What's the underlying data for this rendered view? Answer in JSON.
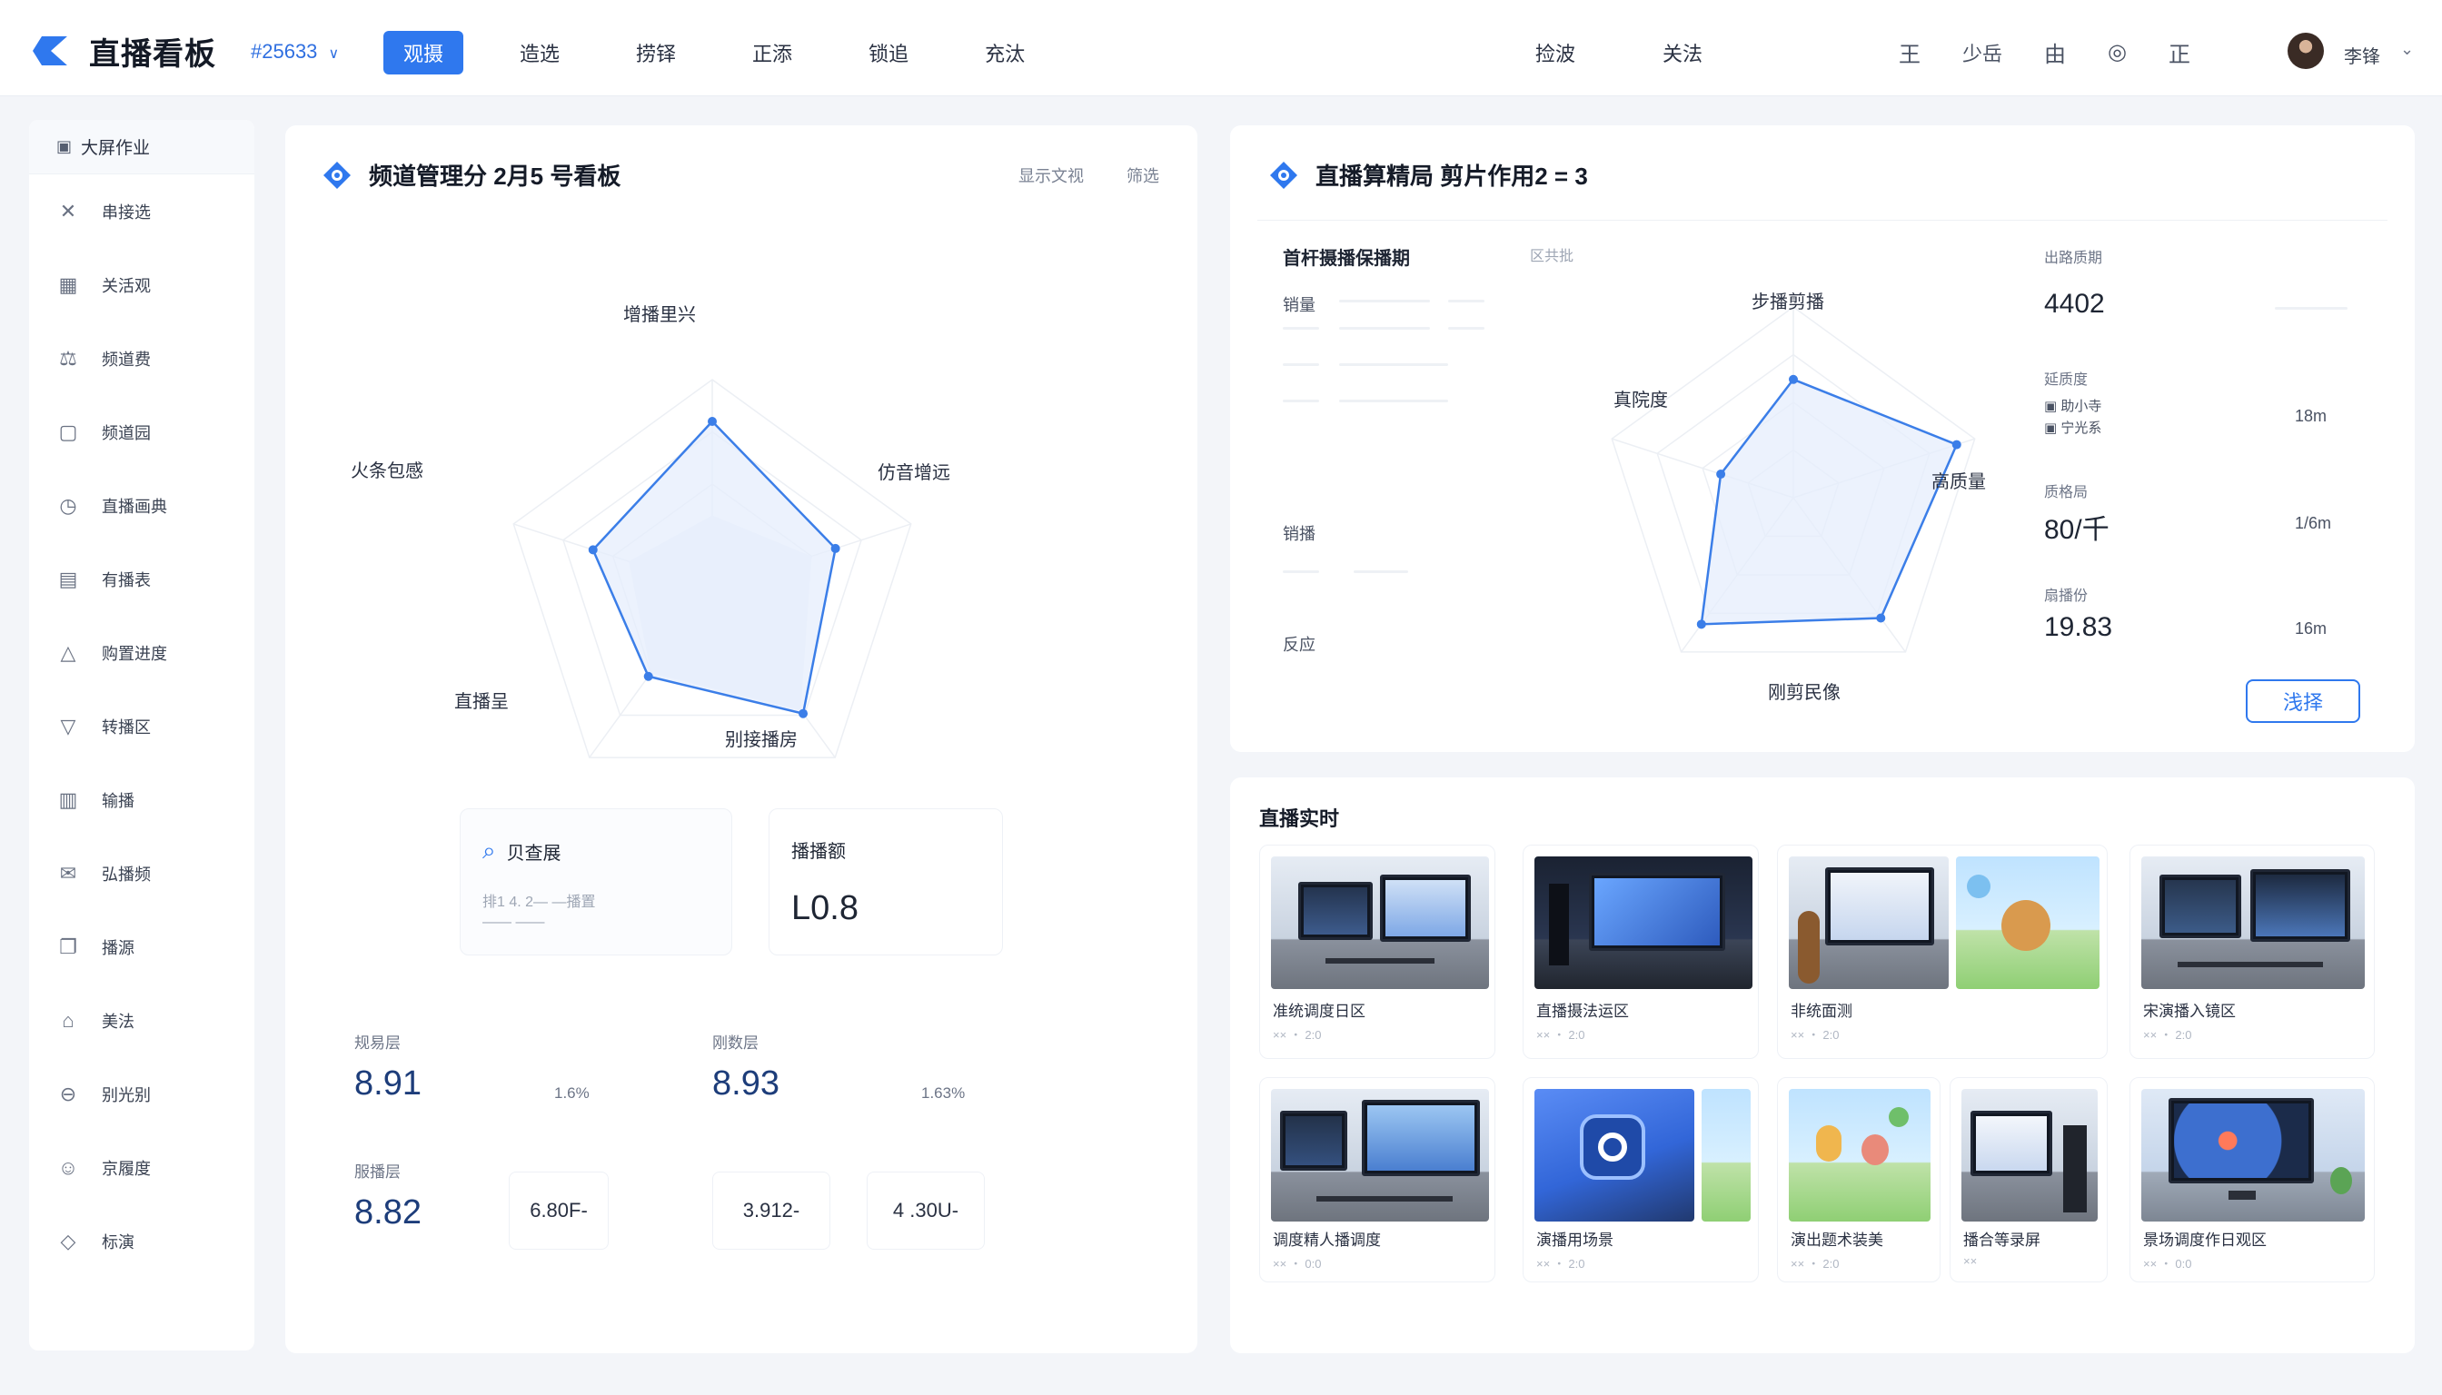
{
  "app": {
    "title": "直播看板",
    "project_id": "#25633",
    "project_caret": "∨"
  },
  "nav": {
    "items": [
      {
        "label": "观摄",
        "active": true
      },
      {
        "label": "造选",
        "active": false
      },
      {
        "label": "捞铎",
        "active": false
      },
      {
        "label": "正添",
        "active": false
      },
      {
        "label": "锁追",
        "active": false
      },
      {
        "label": "充汰",
        "active": false
      }
    ],
    "right_items": [
      "捡波",
      "关法"
    ]
  },
  "toolbar": {
    "items": [
      {
        "label": "王",
        "icon": "menu-icon"
      },
      {
        "label": "少岳",
        "icon": "text-icon"
      },
      {
        "label": "由",
        "icon": "box-icon"
      },
      {
        "label": "◎",
        "icon": "settings-icon"
      },
      {
        "label": "正",
        "icon": "doc-icon"
      }
    ],
    "username": "李锋",
    "user_caret": "⌄"
  },
  "sidebar": {
    "header": "大屏作业",
    "items": [
      {
        "label": "串接选",
        "icon": "tool-icon",
        "glyph": "✕"
      },
      {
        "label": "关活观",
        "icon": "calendar-icon",
        "glyph": "▦"
      },
      {
        "label": "频道费",
        "icon": "scale-icon",
        "glyph": "⚖"
      },
      {
        "label": "频道园",
        "icon": "square-icon",
        "glyph": "▢"
      },
      {
        "label": "直播画典",
        "icon": "clock-icon",
        "glyph": "◷"
      },
      {
        "label": "有播表",
        "icon": "list-icon",
        "glyph": "▤"
      },
      {
        "label": "购置进度",
        "icon": "bell-icon",
        "glyph": "△"
      },
      {
        "label": "转播区",
        "icon": "filter-icon",
        "glyph": "▽"
      },
      {
        "label": "输播",
        "icon": "table-icon",
        "glyph": "▥"
      },
      {
        "label": "弘播频",
        "icon": "mail-icon",
        "glyph": "✉"
      },
      {
        "label": "播源",
        "icon": "copy-icon",
        "glyph": "❐"
      },
      {
        "label": "美法",
        "icon": "lock-icon",
        "glyph": "⌂"
      },
      {
        "label": "别光别",
        "icon": "minus-circle-icon",
        "glyph": "⊖"
      },
      {
        "label": "京履度",
        "icon": "user-icon",
        "glyph": "☺"
      },
      {
        "label": "标演",
        "icon": "tag-icon",
        "glyph": "◇"
      }
    ]
  },
  "panel_a": {
    "title": "频道管理分 2月5 号看板",
    "links": [
      "显示文视",
      "筛选"
    ],
    "radar_labels": [
      "增播里兴",
      "仿音增远",
      "别接播房",
      "直播呈",
      "火条包感"
    ],
    "radar_values": [
      0.8,
      0.62,
      0.74,
      0.52,
      0.6
    ],
    "radar_inner": [
      0.35,
      0.5,
      0.72,
      0.5,
      0.42
    ],
    "search": {
      "title": "贝查展",
      "line1": "排1 4. 2— —播置",
      "line2": "—— ——"
    },
    "summary": {
      "title": "播播额",
      "value": "L0.8"
    },
    "metrics": [
      {
        "label": "规易层",
        "value": "8.91",
        "side": "1.6%"
      },
      {
        "label": "刚数层",
        "value": "8.93",
        "side": "1.63%"
      },
      {
        "label": "服播层",
        "value": "8.82",
        "side": ""
      }
    ],
    "mini_boxes": [
      "6.80F-",
      "3.912-",
      "4 .30U-"
    ]
  },
  "panel_b": {
    "title": "直播算精局 剪片作用2 = 3",
    "table": {
      "header": "首杆摄播保播期",
      "rows": [
        "销量",
        "销播",
        "反应"
      ]
    },
    "radar": {
      "caption": "区共批",
      "labels": [
        "步播剪播",
        "高质量",
        "刚剪民像",
        "真院度"
      ],
      "values": [
        0.62,
        0.9,
        0.78,
        0.82,
        0.4
      ]
    },
    "stats": [
      {
        "label": "出路质期",
        "value": "4402",
        "side": ""
      },
      {
        "label": "延质度",
        "value": "",
        "side": "18m"
      },
      {
        "label": "质格局",
        "value": "80/千",
        "side": "1/6m"
      },
      {
        "label": "扇播份",
        "value": "19.83",
        "side": "16m"
      }
    ],
    "legend": [
      "助小寺",
      "宁光系"
    ],
    "button": "浅择"
  },
  "gallery": {
    "title": "直播实时",
    "tiles": [
      {
        "title": "准统调度日区",
        "sub": "×× ・ 2:0"
      },
      {
        "title": "直播摄法运区",
        "sub": "×× ・ 2:0"
      },
      {
        "title": "非统面测",
        "sub": "×× ・ 2:0"
      },
      {
        "title": "宋演播入镜区",
        "sub": "×× ・ 2:0"
      },
      {
        "title": "调度精人播调度",
        "sub": "×× ・ 0:0"
      },
      {
        "title": "演播用场景",
        "sub": "×× ・ 2:0"
      },
      {
        "title": "演出题术装美",
        "sub": "×× ・ 2:0"
      },
      {
        "title": "播合等录屏",
        "sub": "××"
      },
      {
        "title": "景场调度作日观区",
        "sub": "×× ・ 0:0"
      }
    ]
  },
  "colors": {
    "accent": "#2f78ee",
    "radar_fill": "#e6eefc",
    "radar_stroke": "#3b7ee8"
  }
}
